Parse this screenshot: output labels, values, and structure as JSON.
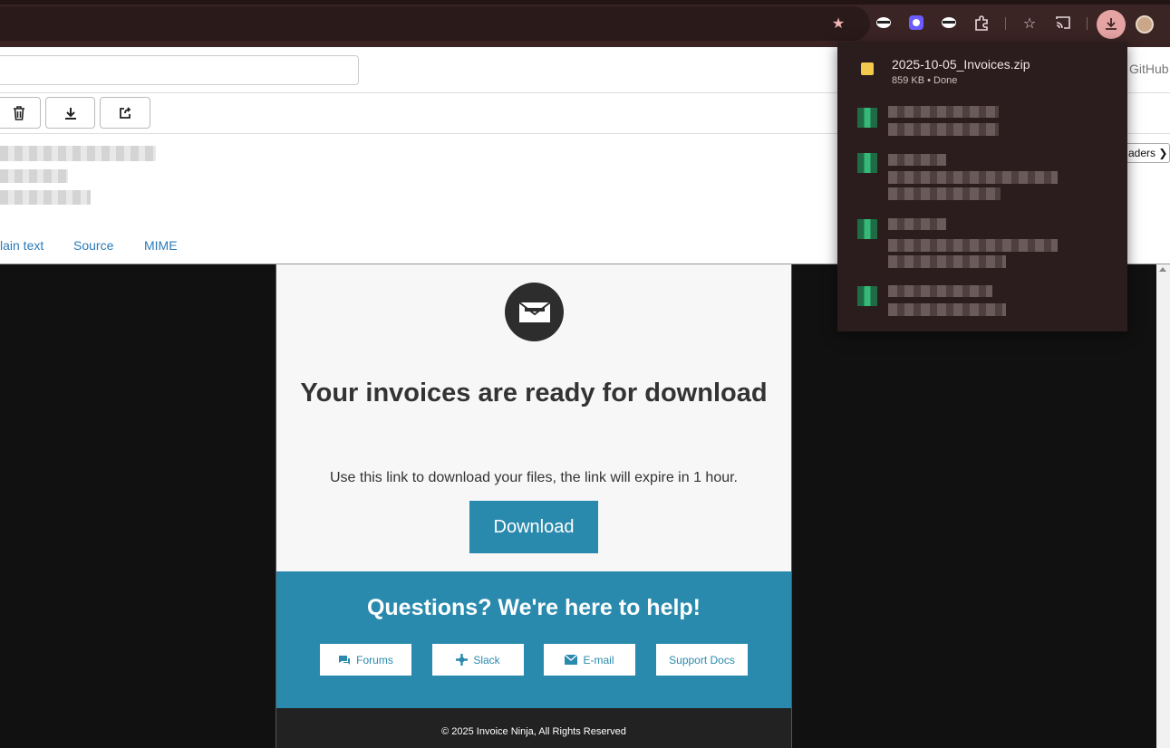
{
  "browser": {
    "icons": [
      "star-icon",
      "extension-mask-icon",
      "extension-gear-icon",
      "extension-mask2-icon",
      "puzzle-icon",
      "bookmarks-icon",
      "cast-icon",
      "download-icon",
      "profile-avatar"
    ]
  },
  "mail": {
    "github_label": "GitHub",
    "view_tabs": [
      {
        "label": "lain text"
      },
      {
        "label": "Source"
      },
      {
        "label": "MIME"
      }
    ],
    "headers_select": "aders"
  },
  "email": {
    "heading": "Your invoices are ready for download",
    "lead": "Use this link to download your files, the link will expire in 1 hour.",
    "download_label": "Download",
    "help_title": "Questions? We're here to help!",
    "help_buttons": [
      {
        "label": "Forums",
        "icon": "chat-icon"
      },
      {
        "label": "Slack",
        "icon": "slack-icon"
      },
      {
        "label": "E-mail",
        "icon": "envelope-icon"
      },
      {
        "label": "Support Docs",
        "icon": ""
      }
    ],
    "footer": "© 2025 Invoice Ninja, All Rights Reserved"
  },
  "downloads": {
    "file_name": "2025-10-05_Invoices.zip",
    "file_status": "859 KB • Done"
  },
  "colors": {
    "accent": "#2a8aad",
    "browser_bar": "#3a2424",
    "panel": "#2b1d1d",
    "download_btn_highlight": "#e6a3a3"
  }
}
